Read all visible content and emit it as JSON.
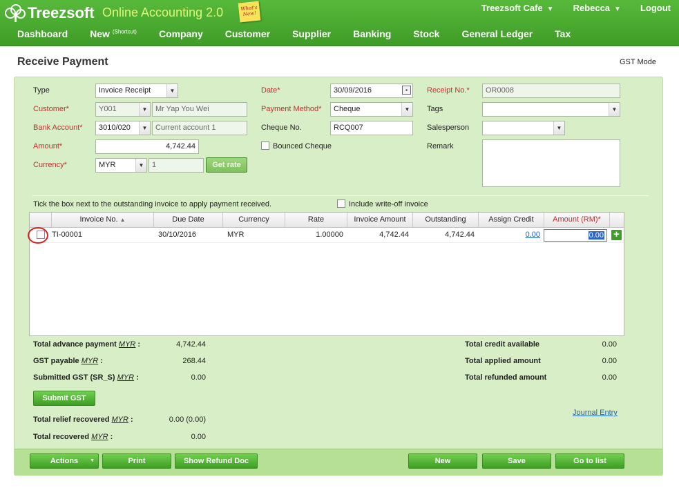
{
  "brand": {
    "logo": "Treezsoft",
    "app_name": "Online Accounting 2.0",
    "whats_new": "What's New!"
  },
  "topright": {
    "company": "Treezsoft Cafe",
    "user": "Rebecca",
    "logout": "Logout"
  },
  "nav": {
    "dashboard": "Dashboard",
    "new": "New",
    "new_sup": "(Shortcut)",
    "company": "Company",
    "customer": "Customer",
    "supplier": "Supplier",
    "banking": "Banking",
    "stock": "Stock",
    "general_ledger": "General Ledger",
    "tax": "Tax"
  },
  "page": {
    "title": "Receive Payment",
    "gst_mode": "GST Mode"
  },
  "form": {
    "type_label": "Type",
    "type_value": "Invoice Receipt",
    "customer_label": "Customer*",
    "customer_code": "Y001",
    "customer_name": "Mr Yap You Wei",
    "bank_label": "Bank Account*",
    "bank_code": "3010/020",
    "bank_name": "Current account 1",
    "amount_label": "Amount*",
    "amount_value": "4,742.44",
    "currency_label": "Currency*",
    "currency_value": "MYR",
    "rate_value": "1",
    "get_rate": "Get rate",
    "date_label": "Date*",
    "date_value": "30/09/2016",
    "payment_method_label": "Payment Method*",
    "payment_method_value": "Cheque",
    "cheque_label": "Cheque No.",
    "cheque_value": "RCQ007",
    "bounced_label": "Bounced Cheque",
    "receipt_label": "Receipt No.*",
    "receipt_value": "OR0008",
    "tags_label": "Tags",
    "tags_value": "",
    "salesperson_label": "Salesperson",
    "salesperson_value": "",
    "remark_label": "Remark",
    "remark_value": ""
  },
  "instructions": "Tick the box next to the outstanding invoice to apply payment received.",
  "include_writeoff": "Include write-off invoice",
  "table": {
    "headers": {
      "invoice_no": "Invoice No.",
      "due_date": "Due Date",
      "currency": "Currency",
      "rate": "Rate",
      "invoice_amount": "Invoice Amount",
      "outstanding": "Outstanding",
      "assign_credit": "Assign Credit",
      "amount": "Amount (RM)*"
    },
    "row": {
      "invoice_no": "TI-00001",
      "due_date": "30/10/2016",
      "currency": "MYR",
      "rate": "1.00000",
      "invoice_amount": "4,742.44",
      "outstanding": "4,742.44",
      "assign_credit": "0.00",
      "amount": "0.00"
    }
  },
  "totals": {
    "advance_label": "Total advance payment",
    "advance_currency": "MYR",
    "advance_value": "4,742.44",
    "gst_label": "GST payable",
    "gst_currency": "MYR",
    "gst_value": "268.44",
    "submitted_label": "Submitted GST (SR_S)",
    "submitted_currency": "MYR",
    "submitted_value": "0.00",
    "submit_gst": "Submit GST",
    "relief_label": "Total relief recovered",
    "relief_currency": "MYR",
    "relief_value": "0.00 (0.00)",
    "recovered_label": "Total recovered",
    "recovered_currency": "MYR",
    "recovered_value": "0.00",
    "credit_label": "Total credit available",
    "credit_value": "0.00",
    "applied_label": "Total applied amount",
    "applied_value": "0.00",
    "refunded_label": "Total refunded amount",
    "refunded_value": "0.00",
    "journal_entry": "Journal Entry"
  },
  "footer": {
    "actions": "Actions",
    "print": "Print",
    "show_refund": "Show Refund Doc",
    "new": "New",
    "save": "Save",
    "go_to_list": "Go to list"
  }
}
